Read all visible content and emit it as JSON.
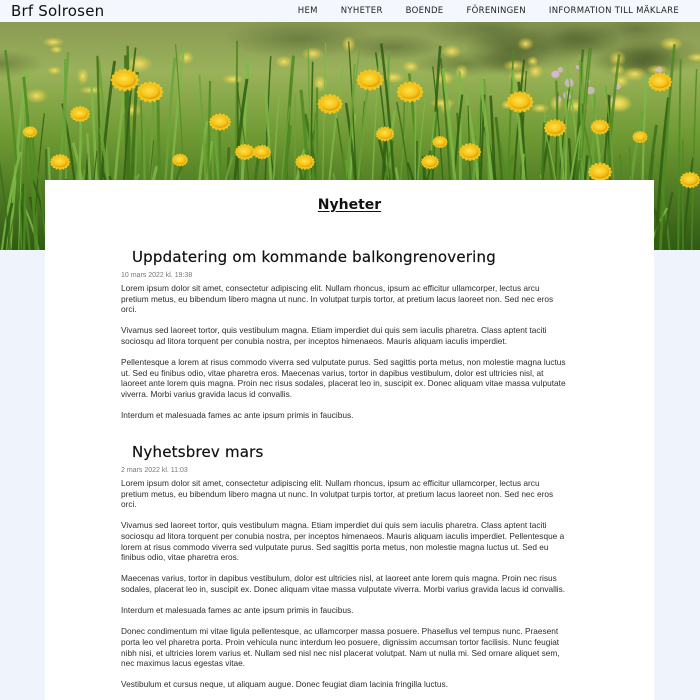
{
  "header": {
    "brand": "Brf Solrosen",
    "nav": [
      "HEM",
      "NYHETER",
      "BOENDE",
      "FÖRENINGEN",
      "INFORMATION TILL MÄKLARE"
    ]
  },
  "hero": {
    "image": "dandelion-meadow"
  },
  "main": {
    "page_title": "Nyheter",
    "articles": [
      {
        "title": "Uppdatering om kommande balkongrenovering",
        "date": "10 mars 2022 kl. 19:38",
        "paragraphs": [
          "Lorem ipsum dolor sit amet, consectetur adipiscing elit. Nullam rhoncus, ipsum ac efficitur ullamcorper, lectus arcu pretium metus, eu bibendum libero magna ut nunc. In volutpat turpis tortor, at pretium lacus laoreet non. Sed nec eros orci.",
          "Vivamus sed laoreet tortor, quis vestibulum magna. Etiam imperdiet dui quis sem iaculis pharetra. Class aptent taciti sociosqu ad litora torquent per conubia nostra, per inceptos himenaeos. Mauris aliquam iaculis imperdiet.",
          "Pellentesque a lorem at risus commodo viverra sed vulputate purus. Sed sagittis porta metus, non molestie magna luctus ut. Sed eu finibus odio, vitae pharetra eros. Maecenas varius, tortor in dapibus vestibulum, dolor est ultricies nisl, at laoreet ante lorem quis magna. Proin nec risus sodales, placerat leo in, suscipit ex. Donec aliquam vitae massa vulputate viverra. Morbi varius gravida lacus id convallis.",
          "Interdum et malesuada fames ac ante ipsum primis in faucibus."
        ]
      },
      {
        "title": "Nyhetsbrev mars",
        "date": "2 mars 2022 kl. 11:03",
        "paragraphs": [
          "Lorem ipsum dolor sit amet, consectetur adipiscing elit. Nullam rhoncus, ipsum ac efficitur ullamcorper, lectus arcu pretium metus, eu bibendum libero magna ut nunc. In volutpat turpis tortor, at pretium lacus laoreet non. Sed nec eros orci.",
          "Vivamus sed laoreet tortor, quis vestibulum magna. Etiam imperdiet dui quis sem iaculis pharetra. Class aptent taciti sociosqu ad litora torquent per conubia nostra, per inceptos himenaeos. Mauris aliquam iaculis imperdiet. Pellentesque a lorem at risus commodo viverra sed vulputate purus. Sed sagittis porta metus, non molestie magna luctus ut. Sed eu finibus odio, vitae pharetra eros.",
          "Maecenas varius, tortor in dapibus vestibulum, dolor est ultricies nisl, at laoreet ante lorem quis magna. Proin nec risus sodales, placerat leo in, suscipit ex. Donec aliquam vitae massa vulputate viverra. Morbi varius gravida lacus id convallis.",
          "Interdum et malesuada fames ac ante ipsum primis in faucibus.",
          "Donec condimentum mi vitae ligula pellentesque, ac ullamcorper massa posuere. Phasellus vel tempus nunc. Praesent porta leo vel pharetra porta. Proin vehicula nunc interdum leo posuere, dignissim accumsan tortor facilisis. Nunc feugiat nibh nisi, et ultricies lorem varius et. Nullam sed nisl nec nisl placerat volutpat. Nam ut nulla mi. Sed ornare aliquet sem, nec maximus lacus egestas vitae.",
          "Vestibulum et cursus neque, ut aliquam augue. Donec feugiat diam lacinia fringilla luctus."
        ]
      }
    ]
  }
}
